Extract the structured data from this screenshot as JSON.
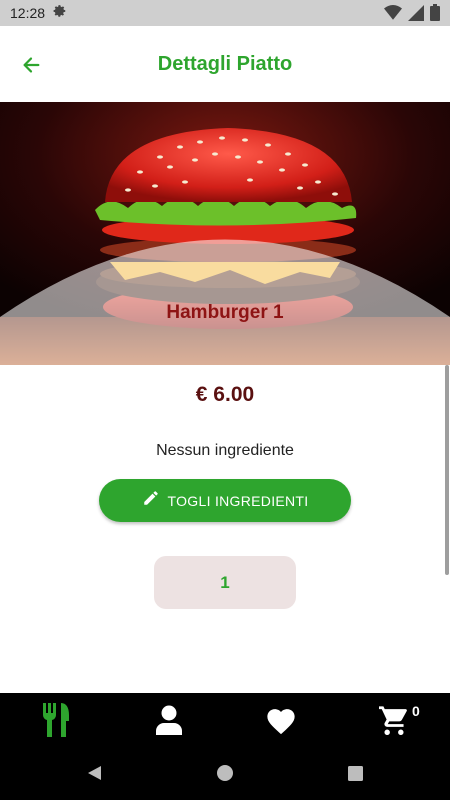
{
  "status_bar": {
    "time": "12:28",
    "icons": [
      "settings-icon",
      "wifi-icon",
      "signal-icon",
      "battery-icon"
    ]
  },
  "app_bar": {
    "title": "Dettagli Piatto",
    "back_icon": "arrow-left-icon"
  },
  "dish": {
    "name": "Hamburger 1",
    "price": "€ 6.00",
    "ingredients_text": "Nessun ingrediente",
    "remove_button_label": "TOGLI INGREDIENTI",
    "remove_button_icon": "pencil-icon",
    "quantity": "1"
  },
  "bottom_nav": {
    "items": [
      {
        "icon": "fork-knife-icon",
        "active": true
      },
      {
        "icon": "user-icon",
        "active": false
      },
      {
        "icon": "heart-icon",
        "active": false
      },
      {
        "icon": "cart-icon",
        "active": false
      }
    ],
    "cart_count": "0"
  },
  "system_nav": [
    "back-triangle-icon",
    "home-circle-icon",
    "recents-square-icon"
  ],
  "colors": {
    "accent_green": "#2ea52e",
    "dish_name": "#8e1414",
    "price": "#5a1010",
    "quantity_bg": "#ede2e2",
    "nav_bg": "#000000"
  }
}
